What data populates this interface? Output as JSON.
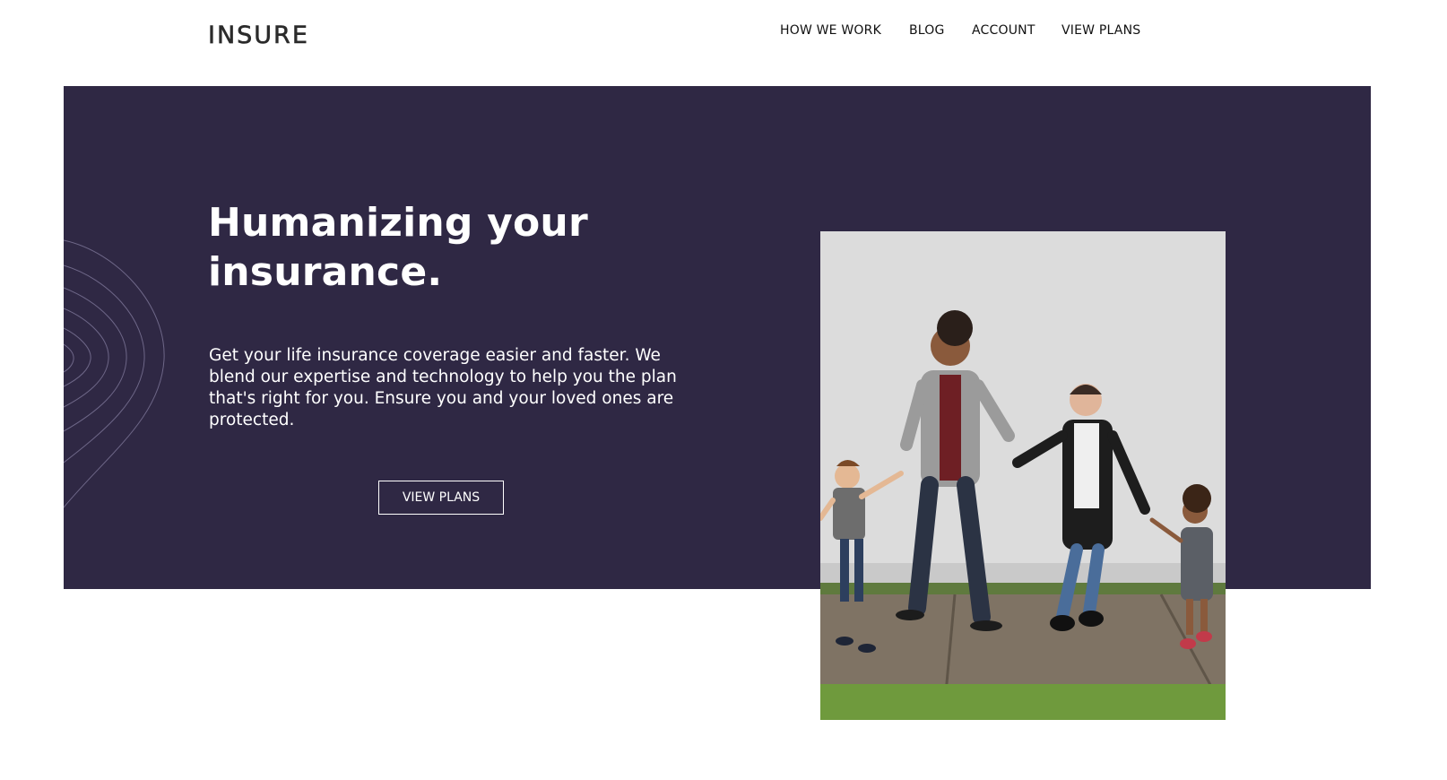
{
  "header": {
    "logo": "INSURE",
    "nav": [
      "HOW WE WORK",
      "BLOG",
      "ACCOUNT",
      "VIEW PLANS"
    ]
  },
  "hero": {
    "title_line1": "Humanizing your",
    "title_line2": "insurance.",
    "description": "Get your life insurance coverage easier and faster. We blend our expertise and technology to help you the plan that's right for you. Ensure you and your loved ones are protected.",
    "cta": "VIEW PLANS",
    "image_alt": "family-photo"
  },
  "colors": {
    "hero_bg": "#2f2844",
    "text_dark": "#111111",
    "white": "#ffffff"
  }
}
